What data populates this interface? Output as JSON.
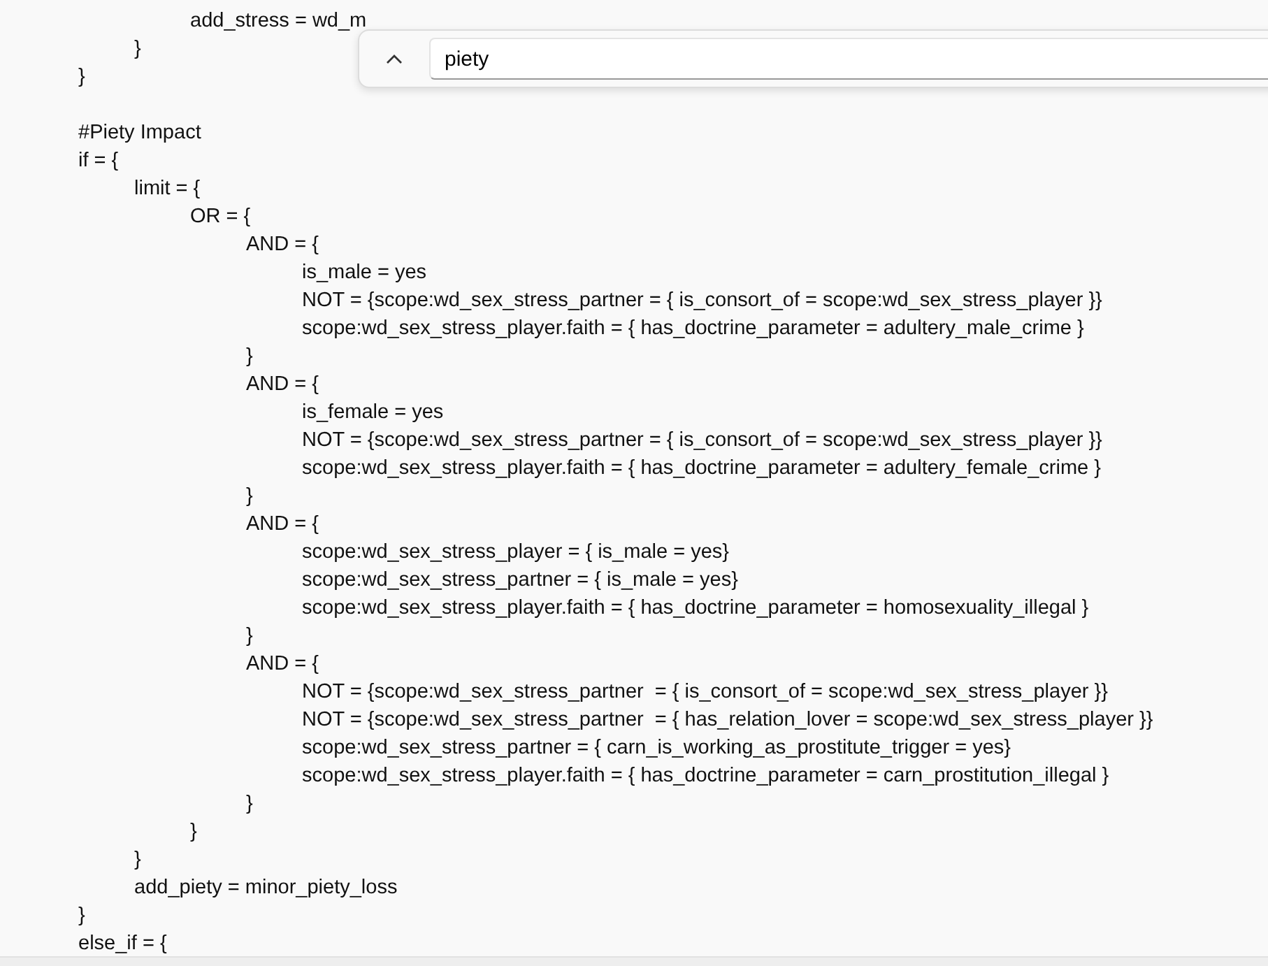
{
  "editor": {
    "lines": [
      {
        "children": [
          {
            "children": [
              {
                "text": "add_stress = wd_m"
              }
            ]
          },
          {
            "text": "}"
          }
        ]
      },
      {
        "text": "}"
      },
      {
        "kind": "blank"
      },
      {
        "text": "#Piety Impact"
      },
      {
        "text": "if = {",
        "children": [
          {
            "text": "limit = {",
            "children": [
              {
                "text": "OR = {",
                "children": [
                  {
                    "text": "AND = {",
                    "children": [
                      {
                        "text": "is_male = yes"
                      },
                      {
                        "text": "NOT = {scope:wd_sex_stress_partner = { is_consort_of = scope:wd_sex_stress_player }}"
                      },
                      {
                        "text": "scope:wd_sex_stress_player.faith = { has_doctrine_parameter = adultery_male_crime }"
                      }
                    ]
                  },
                  {
                    "text": "}"
                  },
                  {
                    "text": "AND = {",
                    "children": [
                      {
                        "text": "is_female = yes"
                      },
                      {
                        "text": "NOT = {scope:wd_sex_stress_partner = { is_consort_of = scope:wd_sex_stress_player }}"
                      },
                      {
                        "text": "scope:wd_sex_stress_player.faith = { has_doctrine_parameter = adultery_female_crime }"
                      }
                    ]
                  },
                  {
                    "text": "}"
                  },
                  {
                    "text": "AND = {",
                    "children": [
                      {
                        "text": "scope:wd_sex_stress_player = { is_male = yes}"
                      },
                      {
                        "text": "scope:wd_sex_stress_partner = { is_male = yes}"
                      },
                      {
                        "text": "scope:wd_sex_stress_player.faith = { has_doctrine_parameter = homosexuality_illegal }"
                      }
                    ]
                  },
                  {
                    "text": "}"
                  },
                  {
                    "text": "AND = {",
                    "children": [
                      {
                        "text": "NOT = {scope:wd_sex_stress_partner  = { is_consort_of = scope:wd_sex_stress_player }}"
                      },
                      {
                        "text": "NOT = {scope:wd_sex_stress_partner  = { has_relation_lover = scope:wd_sex_stress_player }}"
                      },
                      {
                        "text": "scope:wd_sex_stress_partner = { carn_is_working_as_prostitute_trigger = yes}"
                      },
                      {
                        "text": "scope:wd_sex_stress_player.faith = { has_doctrine_parameter = carn_prostitution_illegal }"
                      }
                    ]
                  },
                  {
                    "text": "}"
                  }
                ]
              },
              {
                "text": "}"
              }
            ]
          },
          {
            "text": "}"
          },
          {
            "text": "add_piety = minor_piety_loss"
          }
        ]
      },
      {
        "text": "}"
      },
      {
        "text": "else_if = {"
      }
    ]
  },
  "find_bar": {
    "value": "piety"
  }
}
